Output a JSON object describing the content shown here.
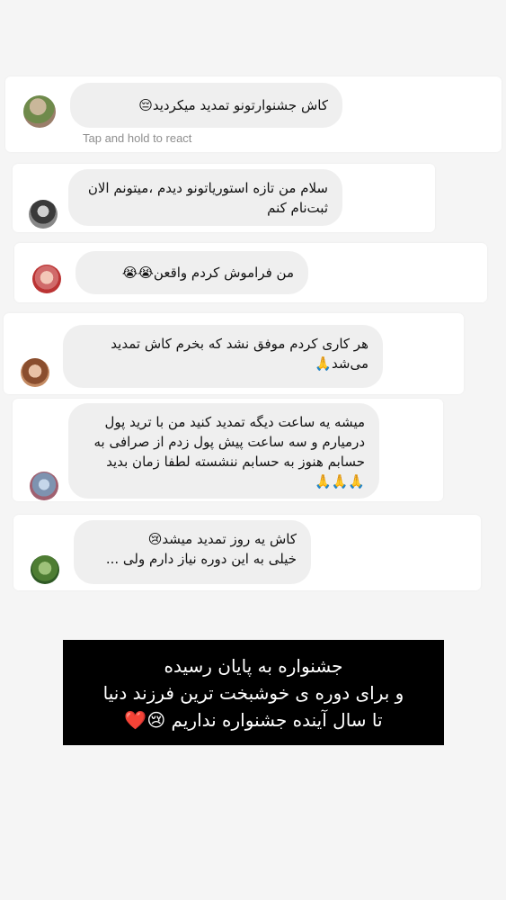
{
  "messages": [
    {
      "text": "کاش جشنوارتونو تمدید میکردید😔"
    },
    {
      "text": "سلام من تازه استوریاتونو دیدم ،میتونم الان\nثبت‌نام کنم"
    },
    {
      "text": "من فراموش کردم واقعن😭😭"
    },
    {
      "text": "هر کاری کردم موفق نشد که بخرم کاش تمدید\nمی‌شد🙏"
    },
    {
      "text": "میشه یه ساعت دیگه تمدید کنید من با ترید پول\nدرمیارم و سه ساعت پیش پول زدم از صرافی به\nحسابم هنوز به حسابم ننشسته لطفا زمان بدید\n🙏🙏🙏"
    },
    {
      "text": "کاش یه روز تمدید میشد😢\nخیلی به این دوره نیاز دارم ولی ..."
    }
  ],
  "tap_hint": "Tap and hold to react",
  "banner": {
    "line1": "جشنواره به پایان رسیده",
    "line2": "و برای دوره ی خوشبخت ترین فرزند دنیا",
    "line3": "تا سال آینده جشنواره نداریم 😢❤️"
  }
}
